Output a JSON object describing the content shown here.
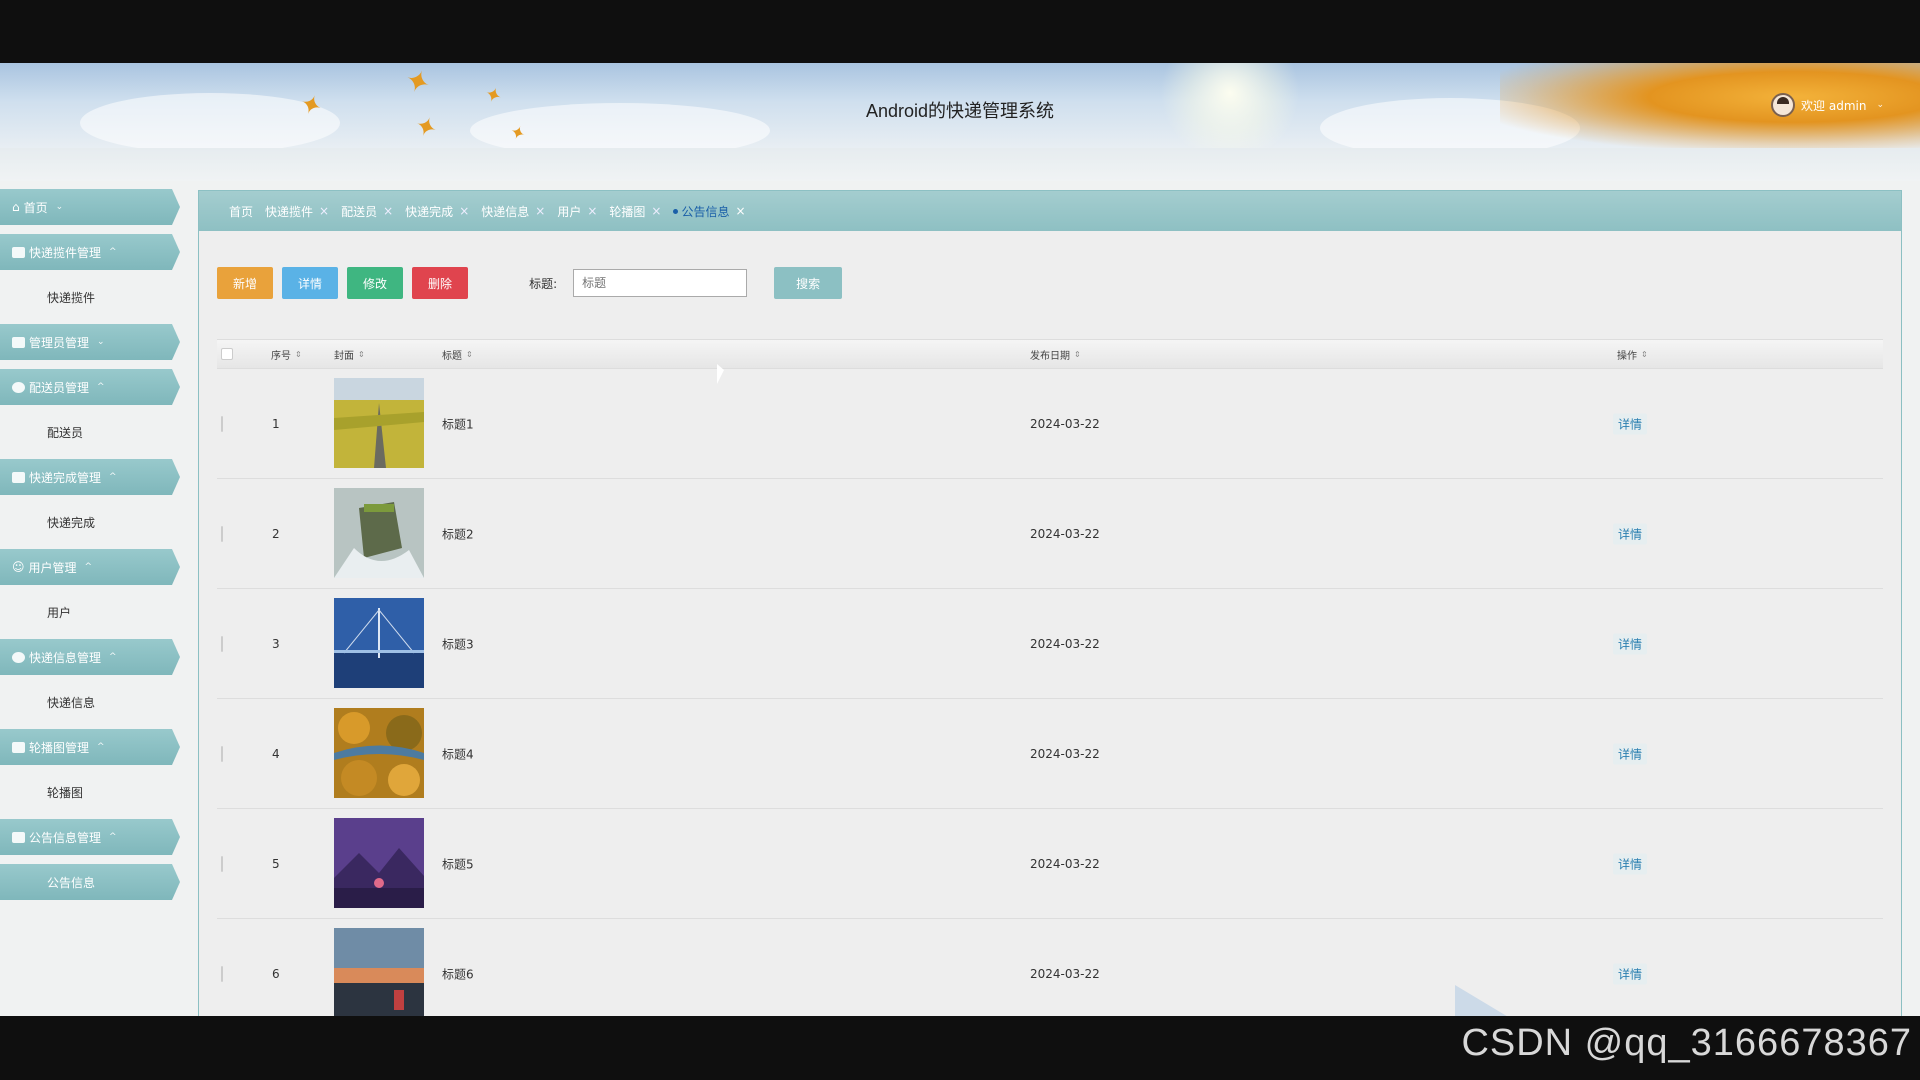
{
  "header": {
    "title": "Android的快递管理系统",
    "welcome": "欢迎 admin"
  },
  "sidebar": {
    "home": "首页",
    "groups": [
      {
        "label": "快递揽件管理",
        "sub": "快递揽件"
      },
      {
        "label": "管理员管理",
        "sub": ""
      },
      {
        "label": "配送员管理",
        "sub": "配送员"
      },
      {
        "label": "快递完成管理",
        "sub": "快递完成"
      },
      {
        "label": "用户管理",
        "sub": "用户"
      },
      {
        "label": "快递信息管理",
        "sub": "快递信息"
      },
      {
        "label": "轮播图管理",
        "sub": "轮播图"
      },
      {
        "label": "公告信息管理",
        "sub": "公告信息"
      }
    ]
  },
  "tabs": [
    "首页",
    "快递揽件",
    "配送员",
    "快递完成",
    "快递信息",
    "用户",
    "轮播图",
    "公告信息"
  ],
  "toolbar": {
    "add": "新增",
    "detail": "详情",
    "edit": "修改",
    "delete": "删除",
    "search_label": "标题:",
    "search_placeholder": "标题",
    "search_button": "搜索"
  },
  "table": {
    "headers": {
      "index": "序号",
      "cover": "封面",
      "title": "标题",
      "date": "发布日期",
      "action": "操作"
    },
    "rows": [
      {
        "index": "1",
        "title": "标题1",
        "date": "2024-03-22",
        "action": "详情"
      },
      {
        "index": "2",
        "title": "标题2",
        "date": "2024-03-22",
        "action": "详情"
      },
      {
        "index": "3",
        "title": "标题3",
        "date": "2024-03-22",
        "action": "详情"
      },
      {
        "index": "4",
        "title": "标题4",
        "date": "2024-03-22",
        "action": "详情"
      },
      {
        "index": "5",
        "title": "标题5",
        "date": "2024-03-22",
        "action": "详情"
      },
      {
        "index": "6",
        "title": "标题6",
        "date": "2024-03-22",
        "action": "详情"
      }
    ]
  },
  "watermark": "CSDN @qq_3166678367",
  "icons": [
    "home-icon",
    "folder-icon",
    "grid-icon",
    "person-icon",
    "box-icon",
    "user-icon",
    "info-icon",
    "image-icon",
    "notice-icon",
    "sort-icon",
    "close-icon",
    "chevron-icon"
  ],
  "colors": {
    "accent": "#8cc0c3",
    "add": "#e9a23b",
    "detail": "#5ab2e6",
    "edit": "#3fb681",
    "delete": "#e0444e"
  }
}
